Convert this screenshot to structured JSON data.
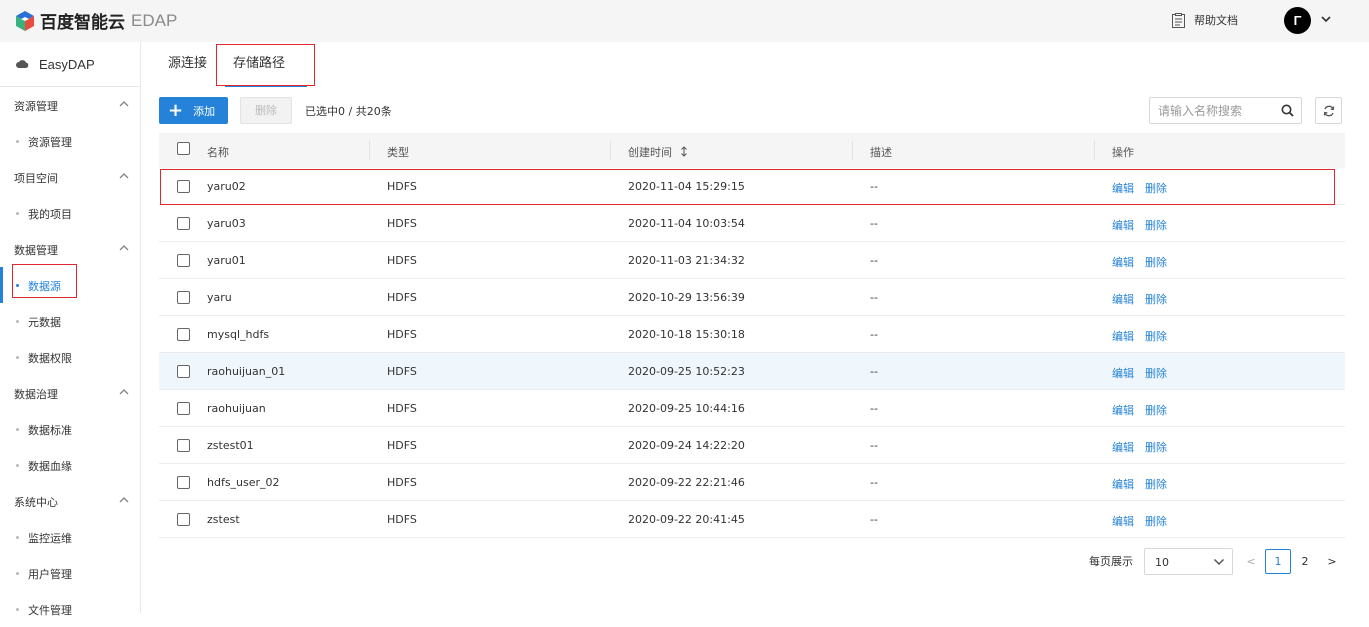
{
  "header": {
    "brand_name": "百度智能云",
    "product": "EDAP",
    "help_label": "帮助文档",
    "avatar_letter": "Γ"
  },
  "sidebar": {
    "app_name": "EasyDAP",
    "groups": [
      {
        "label": "资源管理",
        "items": [
          {
            "label": "资源管理"
          }
        ]
      },
      {
        "label": "项目空间",
        "items": [
          {
            "label": "我的项目"
          }
        ]
      },
      {
        "label": "数据管理",
        "items": [
          {
            "label": "数据源",
            "active": true
          },
          {
            "label": "元数据"
          },
          {
            "label": "数据权限"
          }
        ]
      },
      {
        "label": "数据治理",
        "items": [
          {
            "label": "数据标准"
          },
          {
            "label": "数据血缘"
          }
        ]
      },
      {
        "label": "系统中心",
        "items": [
          {
            "label": "监控运维"
          },
          {
            "label": "用户管理"
          },
          {
            "label": "文件管理"
          }
        ]
      }
    ]
  },
  "tabs": [
    {
      "label": "源连接"
    },
    {
      "label": "存储路径",
      "active": true
    }
  ],
  "toolbar": {
    "add_label": "添加",
    "delete_label": "删除",
    "selection_info": "已选中0 / 共20条",
    "search_placeholder": "请输入名称搜索"
  },
  "table": {
    "columns": [
      "名称",
      "类型",
      "创建时间",
      "描述",
      "操作"
    ],
    "actions": {
      "edit": "编辑",
      "delete": "删除"
    },
    "rows": [
      {
        "name": "yaru02",
        "type": "HDFS",
        "created": "2020-11-04 15:29:15",
        "desc": "--"
      },
      {
        "name": "yaru03",
        "type": "HDFS",
        "created": "2020-11-04 10:03:54",
        "desc": "--"
      },
      {
        "name": "yaru01",
        "type": "HDFS",
        "created": "2020-11-03 21:34:32",
        "desc": "--"
      },
      {
        "name": "yaru",
        "type": "HDFS",
        "created": "2020-10-29 13:56:39",
        "desc": "--"
      },
      {
        "name": "mysql_hdfs",
        "type": "HDFS",
        "created": "2020-10-18 15:30:18",
        "desc": "--"
      },
      {
        "name": "raohuijuan_01",
        "type": "HDFS",
        "created": "2020-09-25 10:52:23",
        "desc": "--"
      },
      {
        "name": "raohuijuan",
        "type": "HDFS",
        "created": "2020-09-25 10:44:16",
        "desc": "--"
      },
      {
        "name": "zstest01",
        "type": "HDFS",
        "created": "2020-09-24 14:22:20",
        "desc": "--"
      },
      {
        "name": "hdfs_user_02",
        "type": "HDFS",
        "created": "2020-09-22 22:21:46",
        "desc": "--"
      },
      {
        "name": "zstest",
        "type": "HDFS",
        "created": "2020-09-22 20:41:45",
        "desc": "--"
      }
    ]
  },
  "pagination": {
    "per_page_label": "每页展示",
    "per_page": "10",
    "prev": "<",
    "pages": [
      "1",
      "2"
    ],
    "current": "1",
    "next": ">"
  },
  "colors": {
    "accent": "#2483d8",
    "annotation_red": "#e0282e"
  }
}
